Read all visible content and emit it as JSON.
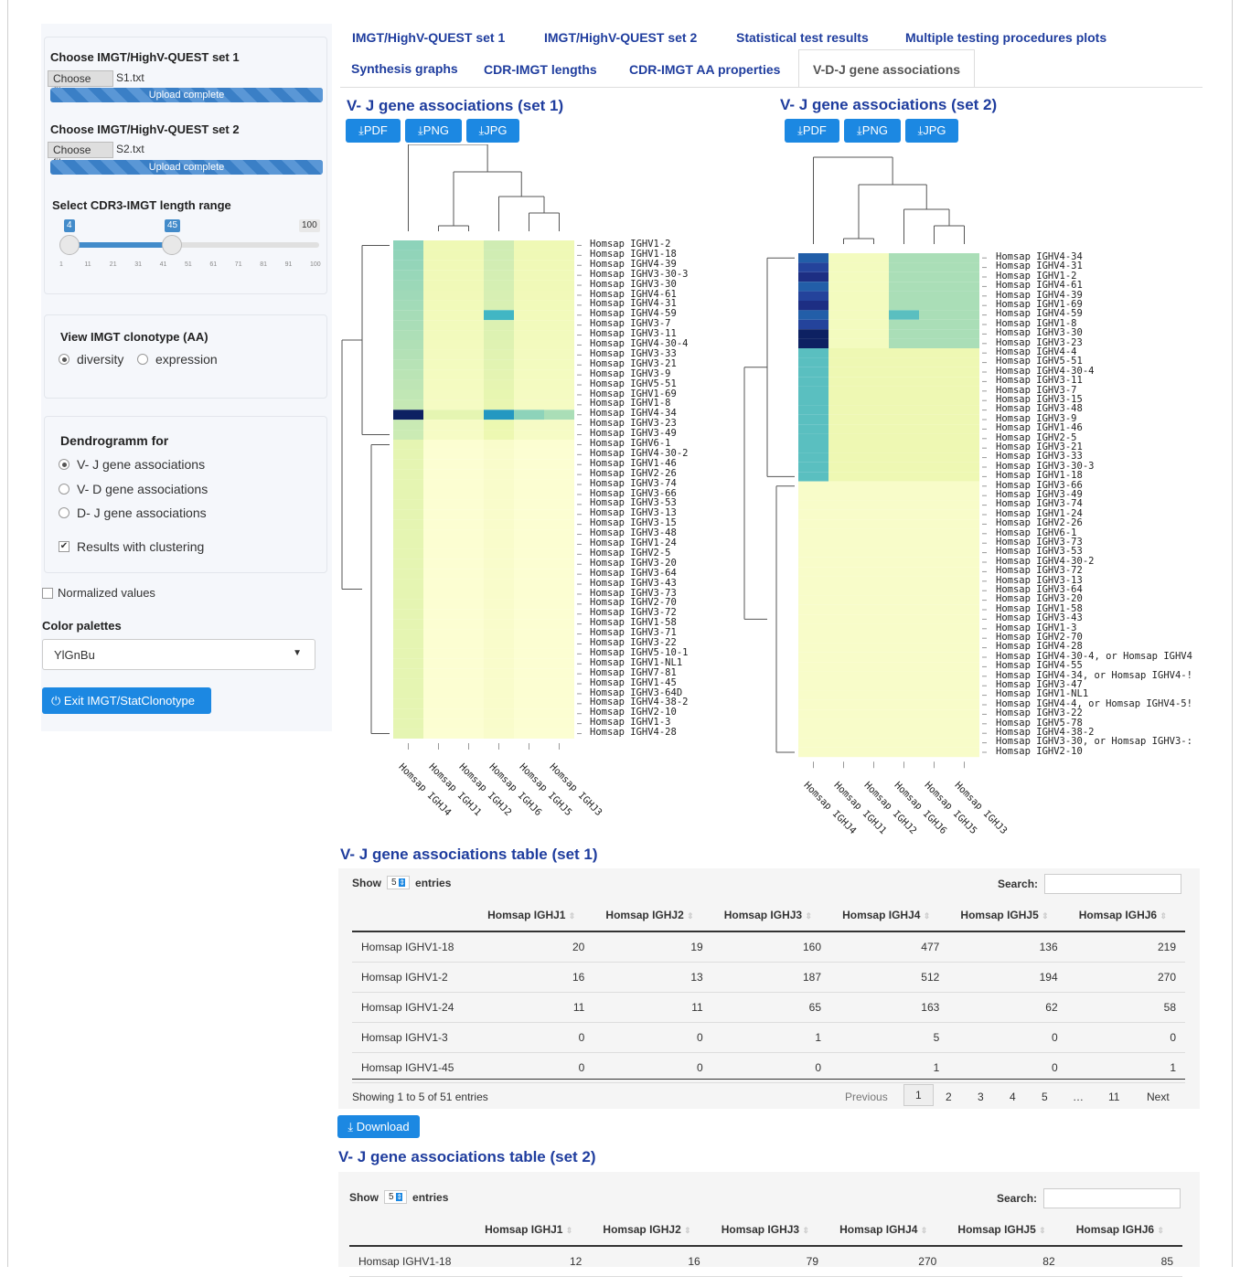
{
  "sidebar": {
    "set1_label": "Choose IMGT/HighV-QUEST set 1",
    "set2_label": "Choose IMGT/HighV-QUEST set 2",
    "choose_file": "Choose file",
    "set1_file": "S1.txt",
    "set2_file": "S2.txt",
    "upload_complete": "Upload complete",
    "cdr3_label": "Select CDR3-IMGT length range",
    "slider_min_value": "4",
    "slider_max_value": "45",
    "slider_max": "100",
    "slider_ticks": [
      "1",
      "11",
      "21",
      "31",
      "41",
      "51",
      "61",
      "71",
      "81",
      "91",
      "100"
    ],
    "clonotype_label": "View IMGT clonotype (AA)",
    "clonotype_options": [
      "diversity",
      "expression"
    ],
    "dendro_label": "Dendrogramm for",
    "dendro_options": [
      "V- J gene associations",
      "V- D gene associations",
      "D- J gene associations"
    ],
    "clustering_label": "Results with clustering",
    "normalized_label": "Normalized values",
    "palette_label": "Color palettes",
    "palette_value": "YlGnBu",
    "exit_label": "Exit IMGT/StatClonotype"
  },
  "tabs": [
    "IMGT/HighV-QUEST set 1",
    "IMGT/HighV-QUEST set 2",
    "Statistical test results",
    "Multiple testing procedures plots",
    "Synthesis graphs",
    "CDR-IMGT lengths",
    "CDR-IMGT AA properties",
    "V-D-J gene associations"
  ],
  "heatmap1": {
    "title": "V- J gene associations (set 1)",
    "buttons": [
      "PDF",
      "PNG",
      "JPG"
    ],
    "rows": [
      "Homsap IGHV1-2",
      "Homsap IGHV1-18",
      "Homsap IGHV4-39",
      "Homsap IGHV3-30-3",
      "Homsap IGHV3-30",
      "Homsap IGHV4-61",
      "Homsap IGHV4-31",
      "Homsap IGHV4-59",
      "Homsap IGHV3-7",
      "Homsap IGHV3-11",
      "Homsap IGHV4-30-4",
      "Homsap IGHV3-33",
      "Homsap IGHV3-21",
      "Homsap IGHV3-9",
      "Homsap IGHV5-51",
      "Homsap IGHV1-69",
      "Homsap IGHV1-8",
      "Homsap IGHV4-34",
      "Homsap IGHV3-23",
      "Homsap IGHV3-49",
      "Homsap IGHV6-1",
      "Homsap IGHV4-30-2",
      "Homsap IGHV1-46",
      "Homsap IGHV2-26",
      "Homsap IGHV3-74",
      "Homsap IGHV3-66",
      "Homsap IGHV3-53",
      "Homsap IGHV3-13",
      "Homsap IGHV3-15",
      "Homsap IGHV3-48",
      "Homsap IGHV1-24",
      "Homsap IGHV2-5",
      "Homsap IGHV3-20",
      "Homsap IGHV3-64",
      "Homsap IGHV3-43",
      "Homsap IGHV3-73",
      "Homsap IGHV2-70",
      "Homsap IGHV3-72",
      "Homsap IGHV1-58",
      "Homsap IGHV3-71",
      "Homsap IGHV3-22",
      "Homsap IGHV5-10-1",
      "Homsap IGHV1-NL1",
      "Homsap IGHV7-81",
      "Homsap IGHV1-45",
      "Homsap IGHV3-64D",
      "Homsap IGHV4-38-2",
      "Homsap IGHV2-10",
      "Homsap IGHV1-3",
      "Homsap IGHV4-28"
    ],
    "cols": [
      "Homsap IGHJ4",
      "Homsap IGHJ1",
      "Homsap IGHJ2",
      "Homsap IGHJ6",
      "Homsap IGHJ5",
      "Homsap IGHJ3"
    ]
  },
  "heatmap2": {
    "title": "V- J gene associations (set 2)",
    "buttons": [
      "PDF",
      "PNG",
      "JPG"
    ],
    "rows": [
      "Homsap IGHV4-34",
      "Homsap IGHV4-31",
      "Homsap IGHV1-2",
      "Homsap IGHV4-61",
      "Homsap IGHV4-39",
      "Homsap IGHV1-69",
      "Homsap IGHV4-59",
      "Homsap IGHV1-8",
      "Homsap IGHV3-30",
      "Homsap IGHV3-23",
      "Homsap IGHV4-4",
      "Homsap IGHV5-51",
      "Homsap IGHV4-30-4",
      "Homsap IGHV3-11",
      "Homsap IGHV3-7",
      "Homsap IGHV3-15",
      "Homsap IGHV3-48",
      "Homsap IGHV3-9",
      "Homsap IGHV1-46",
      "Homsap IGHV2-5",
      "Homsap IGHV3-21",
      "Homsap IGHV3-33",
      "Homsap IGHV3-30-3",
      "Homsap IGHV1-18",
      "Homsap IGHV3-66",
      "Homsap IGHV3-49",
      "Homsap IGHV3-74",
      "Homsap IGHV1-24",
      "Homsap IGHV2-26",
      "Homsap IGHV6-1",
      "Homsap IGHV3-73",
      "Homsap IGHV3-53",
      "Homsap IGHV4-30-2",
      "Homsap IGHV3-72",
      "Homsap IGHV3-13",
      "Homsap IGHV3-64",
      "Homsap IGHV3-20",
      "Homsap IGHV1-58",
      "Homsap IGHV3-43",
      "Homsap IGHV1-3",
      "Homsap IGHV2-70",
      "Homsap IGHV4-28",
      "Homsap IGHV4-30-4, or Homsap IGHV4",
      "Homsap IGHV4-55",
      "Homsap IGHV4-34, or Homsap IGHV4-!",
      "Homsap IGHV3-47",
      "Homsap IGHV1-NL1",
      "Homsap IGHV4-4, or Homsap IGHV4-5!",
      "Homsap IGHV3-22",
      "Homsap IGHV5-78",
      "Homsap IGHV4-38-2",
      "Homsap IGHV3-30, or Homsap IGHV3-:",
      "Homsap IGHV2-10"
    ],
    "cols": [
      "Homsap IGHJ4",
      "Homsap IGHJ1",
      "Homsap IGHJ2",
      "Homsap IGHJ6",
      "Homsap IGHJ5",
      "Homsap IGHJ3"
    ]
  },
  "table1": {
    "title": "V- J gene associations table (set 1)",
    "show": "Show",
    "entries_value": "5",
    "entries": "entries",
    "search": "Search:",
    "headers": [
      "",
      "Homsap IGHJ1",
      "Homsap IGHJ2",
      "Homsap IGHJ3",
      "Homsap IGHJ4",
      "Homsap IGHJ5",
      "Homsap IGHJ6"
    ],
    "rows": [
      [
        "Homsap IGHV1-18",
        "20",
        "19",
        "160",
        "477",
        "136",
        "219"
      ],
      [
        "Homsap IGHV1-2",
        "16",
        "13",
        "187",
        "512",
        "194",
        "270"
      ],
      [
        "Homsap IGHV1-24",
        "11",
        "11",
        "65",
        "163",
        "62",
        "58"
      ],
      [
        "Homsap IGHV1-3",
        "0",
        "0",
        "1",
        "5",
        "0",
        "0"
      ],
      [
        "Homsap IGHV1-45",
        "0",
        "0",
        "0",
        "1",
        "0",
        "1"
      ]
    ],
    "info": "Showing 1 to 5 of 51 entries",
    "pagination": [
      "Previous",
      "1",
      "2",
      "3",
      "4",
      "5",
      "…",
      "11",
      "Next"
    ],
    "download": "Download"
  },
  "table2": {
    "title": "V- J gene associations table (set 2)",
    "show": "Show",
    "entries_value": "5",
    "entries": "entries",
    "search": "Search:",
    "headers": [
      "",
      "Homsap IGHJ1",
      "Homsap IGHJ2",
      "Homsap IGHJ3",
      "Homsap IGHJ4",
      "Homsap IGHJ5",
      "Homsap IGHJ6"
    ],
    "rows": [
      [
        "Homsap IGHV1-18",
        "12",
        "16",
        "79",
        "270",
        "82",
        "85"
      ]
    ]
  },
  "colors": {
    "accent": "#1c88e2",
    "tab_text": "#1f3d9e",
    "heat_low": "#ffffd9",
    "heat_high": "#081d58"
  }
}
